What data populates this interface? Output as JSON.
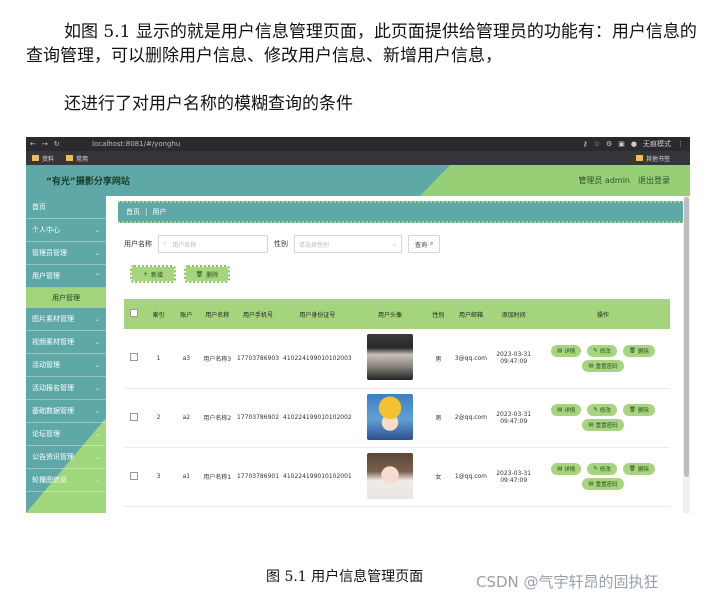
{
  "doc": {
    "paragraph1": "如图 5.1 显示的就是用户信息管理页面，此页面提供给管理员的功能有：用户信息的查询管理，可以删除用户信息、修改用户信息、新增用户信息，",
    "paragraph2": "还进行了对用户名称的模糊查询的条件",
    "caption": "图 5.1  用户信息管理页面",
    "watermark": "CSDN @气宇轩昂的固执狂"
  },
  "browser": {
    "url": "localhost:8081/#/yonghu",
    "profile": "无痕模式",
    "bookmarks": [
      "资料",
      "常用"
    ],
    "bookmarks_right": "其他书签"
  },
  "app": {
    "title": "“有光”摄影分享网站",
    "admin_label": "管理员 admin",
    "logout_label": "退出登录",
    "colors": {
      "teal": "#5ea8a8",
      "green": "#a4d47c"
    }
  },
  "sidebar": {
    "items": [
      {
        "label": "首页"
      },
      {
        "label": "个人中心"
      },
      {
        "label": "管理员管理"
      },
      {
        "label": "用户管理"
      },
      {
        "label": "图片素材管理"
      },
      {
        "label": "视频素材管理"
      },
      {
        "label": "活动管理"
      },
      {
        "label": "活动报名管理"
      },
      {
        "label": "基础数据管理"
      },
      {
        "label": "论坛管理"
      },
      {
        "label": "公告资讯管理"
      },
      {
        "label": "轮播图信息"
      }
    ],
    "sub_active": "用户管理"
  },
  "breadcrumb": {
    "home": "首页",
    "current": "用户"
  },
  "search": {
    "name_label": "用户名称",
    "name_placeholder": "用户名称",
    "gender_label": "性别",
    "gender_placeholder": "请选择性别",
    "query_label": "查询"
  },
  "actions": {
    "add_label": "新增",
    "delete_label": "删除"
  },
  "table": {
    "headers": [
      "索引",
      "账户",
      "用户名称",
      "用户手机号",
      "用户身份证号",
      "用户头像",
      "性别",
      "用户邮箱",
      "添加时间",
      "操作"
    ],
    "rows": [
      {
        "index": "1",
        "account": "a3",
        "name": "用户名称3",
        "phone": "17703786903",
        "idcard": "410224199010102003",
        "gender": "男",
        "email": "3@qq.com",
        "time": "2023-03-31 09:47:09",
        "avatar": "portrait-black-white"
      },
      {
        "index": "2",
        "account": "a2",
        "name": "用户名称2",
        "phone": "17703786902",
        "idcard": "410224199010102002",
        "gender": "男",
        "email": "2@qq.com",
        "time": "2023-03-31 09:47:09",
        "avatar": "cartoon-boy"
      },
      {
        "index": "3",
        "account": "a1",
        "name": "用户名称1",
        "phone": "17703786901",
        "idcard": "410224199010102001",
        "gender": "女",
        "email": "1@qq.com",
        "time": "2023-03-31 09:47:09",
        "avatar": "woman-portrait"
      }
    ],
    "ops": {
      "detail": "详情",
      "edit": "修改",
      "delete": "删除",
      "reset": "重置密码"
    }
  }
}
